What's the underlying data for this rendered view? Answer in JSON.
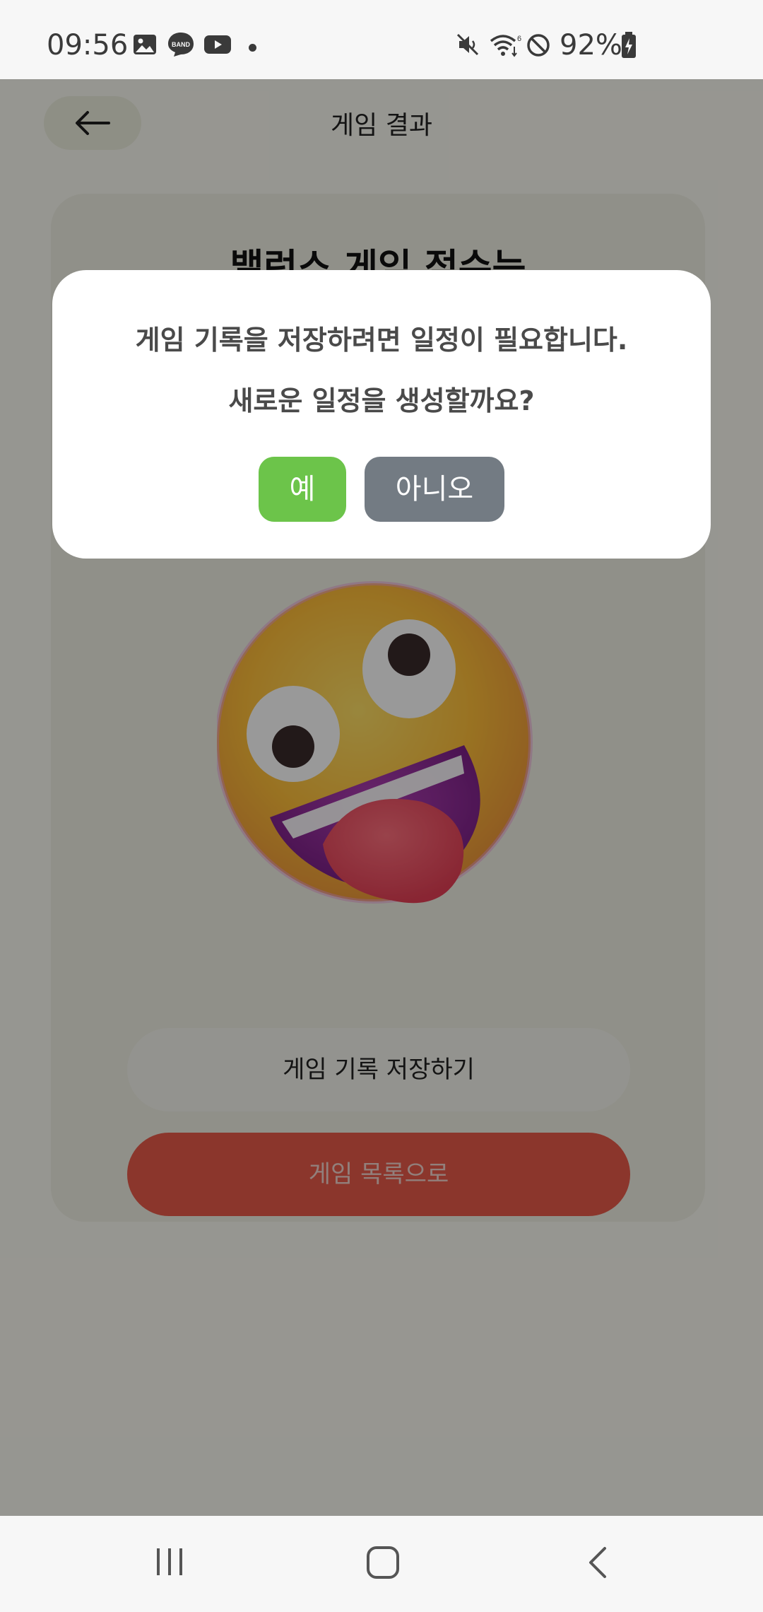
{
  "status_bar": {
    "time": "09:56",
    "notification_icons": [
      "gallery-icon",
      "band-icon",
      "youtube-icon",
      "more-dot-icon"
    ],
    "band_label": "BAND",
    "system_icons": [
      "mute-icon",
      "wifi-icon",
      "blocked-icon",
      "battery-charging-icon"
    ],
    "battery_percent": "92%"
  },
  "header": {
    "title": "게임 결과",
    "back_icon": "arrow-left-icon"
  },
  "card": {
    "title": "밸런스 게임 점수는",
    "emoji": "zany-face-emoji",
    "save_button": "게임 기록 저장하기",
    "list_button": "게임 목록으로"
  },
  "dialog": {
    "line1": "게임 기록을 저장하려면 일정이 필요합니다.",
    "line2": "새로운 일정을 생성할까요?",
    "yes_label": "예",
    "no_label": "아니오"
  },
  "colors": {
    "yes_button": "#6cc44a",
    "no_button": "#737b83",
    "list_button": "#e85a4a",
    "overlay": "rgba(0,0,0,0.40)"
  },
  "nav_bar": {
    "items": [
      "recents-icon",
      "home-icon",
      "back-icon"
    ]
  }
}
